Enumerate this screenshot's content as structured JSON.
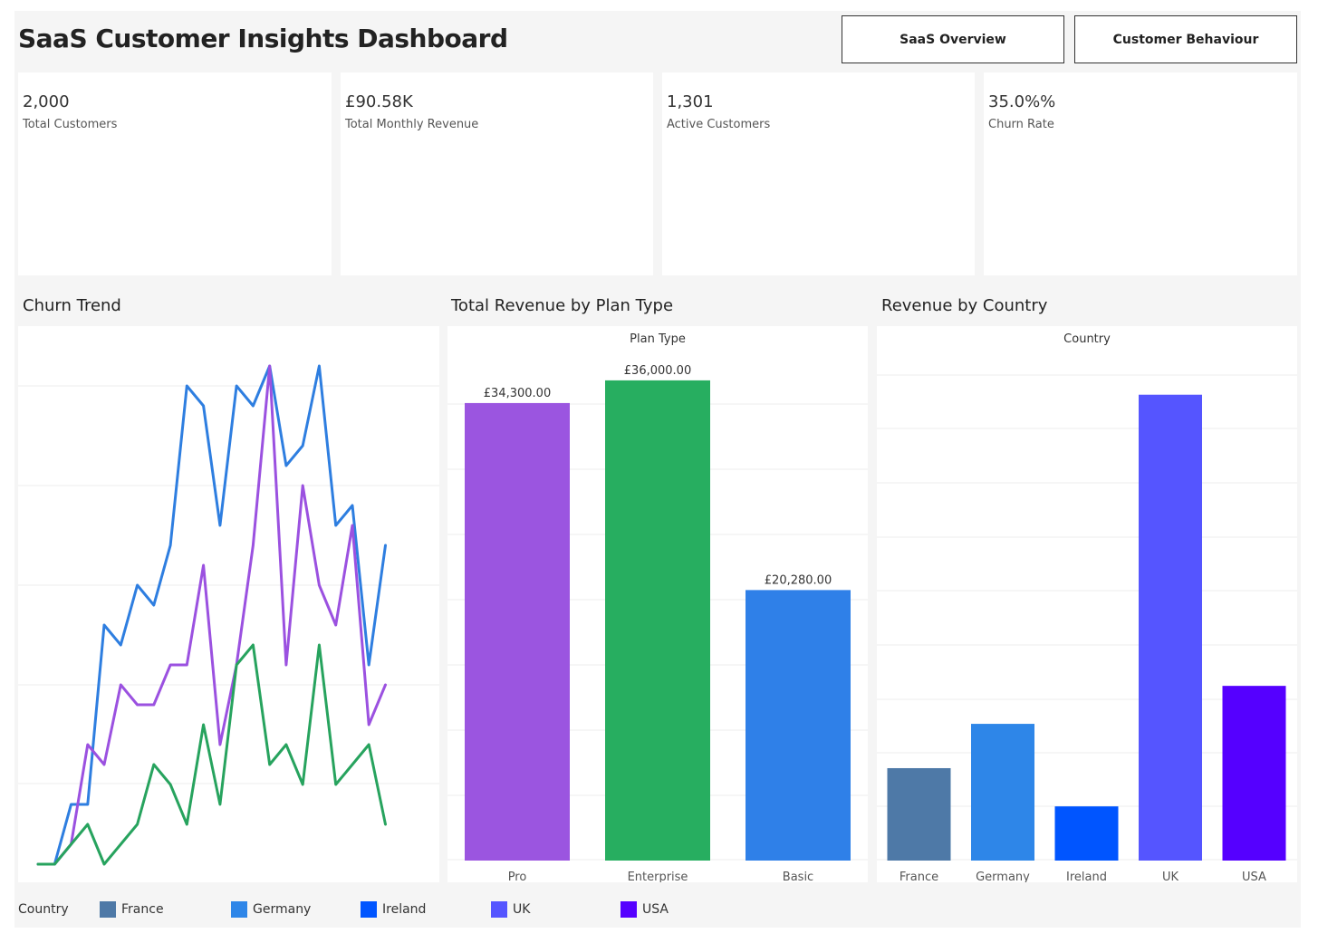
{
  "header": {
    "title": "SaaS Customer Insights Dashboard",
    "nav_overview": "SaaS Overview",
    "nav_behaviour": "Customer Behaviour"
  },
  "kpis": [
    {
      "value": "2,000",
      "label": "Total Customers"
    },
    {
      "value": "£90.58K",
      "label": "Total Monthly Revenue"
    },
    {
      "value": "1,301",
      "label": "Active Customers"
    },
    {
      "value": "35.0%%",
      "label": "Churn Rate"
    }
  ],
  "sections": {
    "churn": "Churn Trend",
    "plan": "Total Revenue by Plan Type",
    "country": "Revenue by Country"
  },
  "legend": {
    "title": "Country",
    "items": [
      {
        "name": "France",
        "color": "#4e79a7"
      },
      {
        "name": "Germany",
        "color": "#2e86e8"
      },
      {
        "name": "Ireland",
        "color": "#0055ff"
      },
      {
        "name": "UK",
        "color": "#5555ff"
      },
      {
        "name": "USA",
        "color": "#5500ff"
      }
    ]
  },
  "chart_data": [
    {
      "type": "line",
      "title": "Churn Trend",
      "x": [
        1,
        2,
        3,
        4,
        5,
        6,
        7,
        8,
        9,
        10,
        11,
        12,
        13,
        14,
        15,
        16,
        17,
        18,
        19,
        20,
        21,
        22,
        23,
        24
      ],
      "ylim": [
        0,
        100
      ],
      "grid": true,
      "series": [
        {
          "color": "#2e7ee0",
          "values": [
            0,
            0,
            12,
            12,
            48,
            44,
            56,
            52,
            64,
            96,
            92,
            68,
            96,
            92,
            100,
            80,
            84,
            100,
            68,
            72,
            40,
            64
          ]
        },
        {
          "color": "#9b51e0",
          "values": [
            0,
            0,
            4,
            24,
            20,
            36,
            32,
            32,
            40,
            40,
            60,
            24,
            40,
            64,
            100,
            40,
            76,
            56,
            48,
            68,
            28,
            36
          ]
        },
        {
          "color": "#27a35e",
          "values": [
            0,
            0,
            4,
            8,
            0,
            4,
            8,
            20,
            16,
            8,
            28,
            12,
            40,
            44,
            20,
            24,
            16,
            44,
            16,
            20,
            24,
            8
          ]
        }
      ]
    },
    {
      "type": "bar",
      "title": "Total Revenue by Plan Type",
      "xlabel": "Plan Type",
      "categories": [
        "Pro",
        "Enterprise",
        "Basic"
      ],
      "values": [
        34300,
        36000,
        20280
      ],
      "labels": [
        "£34,300.00",
        "£36,000.00",
        "£20,280.00"
      ],
      "colors": [
        "#9b55e0",
        "#27ae60",
        "#2f80e8"
      ],
      "ylim": [
        0,
        40000
      ],
      "grid": true
    },
    {
      "type": "bar",
      "title": "Revenue by Country",
      "xlabel": "Country",
      "categories": [
        "France",
        "Germany",
        "Ireland",
        "UK",
        "USA"
      ],
      "values": [
        3650,
        5400,
        2140,
        18400,
        6900
      ],
      "colors": [
        "#4e79a7",
        "#2e86e8",
        "#0055ff",
        "#5555ff",
        "#5500ff"
      ],
      "ylim": [
        0,
        20000
      ],
      "grid": true
    }
  ]
}
